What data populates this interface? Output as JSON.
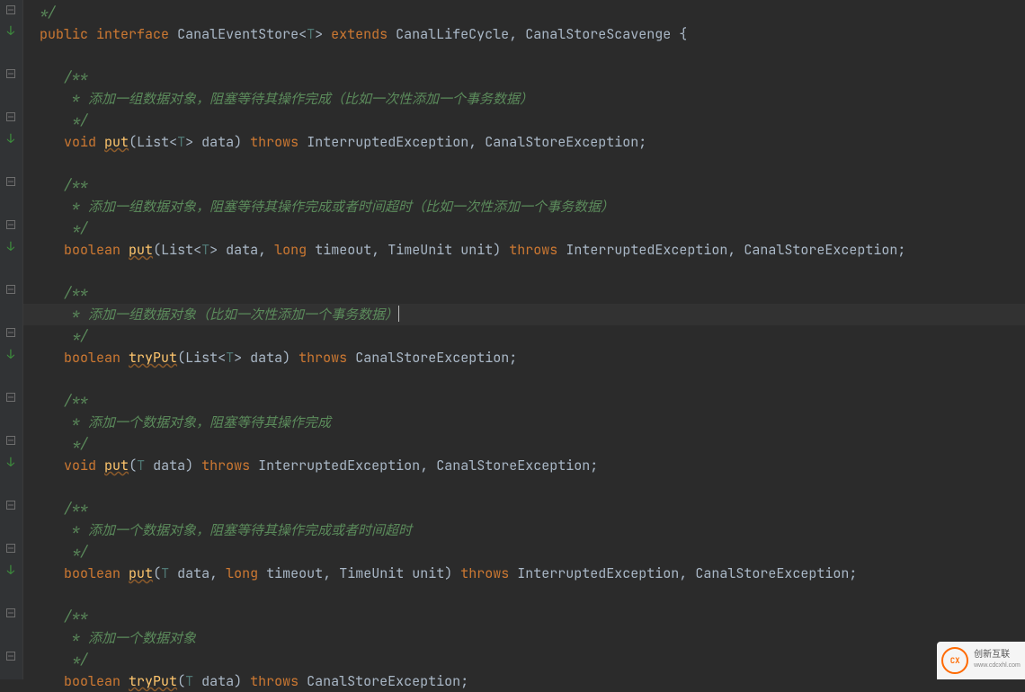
{
  "code": {
    "l1": "  */",
    "l2a": "  ",
    "l2_kw1": "public",
    "l2_s1": " ",
    "l2_kw2": "interface",
    "l2_s2": " ",
    "l2_id1": "CanalEventStore",
    "l2_p1": "<",
    "l2_tp": "T",
    "l2_p2": "> ",
    "l2_kw3": "extends",
    "l2_s3": " ",
    "l2_id2": "CanalLifeCycle",
    "l2_p3": ", ",
    "l2_id3": "CanalStoreScavenge",
    "l2_s4": " ",
    "l2_br": "{",
    "l4": "     /**",
    "l5": "      * 添加一组数据对象，阻塞等待其操作完成（比如一次性添加一个事务数据）",
    "l6": "      */",
    "l7a": "     ",
    "l7_kw": "void",
    "l7_s": " ",
    "l7_m": "put",
    "l7_p1": "(",
    "l7_id1": "List",
    "l7_p2": "<",
    "l7_tp": "T",
    "l7_p3": "> ",
    "l7_id2": "data",
    "l7_p4": ") ",
    "l7_kw2": "throws",
    "l7_s2": " ",
    "l7_id3": "InterruptedException",
    "l7_p5": ", ",
    "l7_id4": "CanalStoreException",
    "l7_p6": ";",
    "l9": "     /**",
    "l10": "      * 添加一组数据对象，阻塞等待其操作完成或者时间超时（比如一次性添加一个事务数据）",
    "l11": "      */",
    "l12a": "     ",
    "l12_kw": "boolean",
    "l12_s": " ",
    "l12_m": "put",
    "l12_p1": "(",
    "l12_id1": "List",
    "l12_p2": "<",
    "l12_tp": "T",
    "l12_p3": "> ",
    "l12_id2": "data",
    "l12_p4": ", ",
    "l12_kw2": "long",
    "l12_s2": " ",
    "l12_id3": "timeout",
    "l12_p5": ", ",
    "l12_id4": "TimeUnit",
    "l12_s3": " ",
    "l12_id5": "unit",
    "l12_p6": ") ",
    "l12_kw3": "throws",
    "l12_s4": " ",
    "l12_id6": "InterruptedException",
    "l12_p7": ", ",
    "l12_id7": "CanalStoreException",
    "l12_p8": ";",
    "l14": "     /**",
    "l15": "      * 添加一组数据对象（比如一次性添加一个事务数据）",
    "l16": "      */",
    "l17a": "     ",
    "l17_kw": "boolean",
    "l17_s": " ",
    "l17_m": "tryPut",
    "l17_p1": "(",
    "l17_id1": "List",
    "l17_p2": "<",
    "l17_tp": "T",
    "l17_p3": "> ",
    "l17_id2": "data",
    "l17_p4": ") ",
    "l17_kw2": "throws",
    "l17_s2": " ",
    "l17_id3": "CanalStoreException",
    "l17_p5": ";",
    "l19": "     /**",
    "l20": "      * 添加一个数据对象，阻塞等待其操作完成",
    "l21": "      */",
    "l22a": "     ",
    "l22_kw": "void",
    "l22_s": " ",
    "l22_m": "put",
    "l22_p1": "(",
    "l22_tp": "T",
    "l22_s2": " ",
    "l22_id2": "data",
    "l22_p2": ") ",
    "l22_kw2": "throws",
    "l22_s3": " ",
    "l22_id3": "InterruptedException",
    "l22_p3": ", ",
    "l22_id4": "CanalStoreException",
    "l22_p4": ";",
    "l24": "     /**",
    "l25": "      * 添加一个数据对象，阻塞等待其操作完成或者时间超时",
    "l26": "      */",
    "l27a": "     ",
    "l27_kw": "boolean",
    "l27_s": " ",
    "l27_m": "put",
    "l27_p1": "(",
    "l27_tp": "T",
    "l27_s2": " ",
    "l27_id2": "data",
    "l27_p2": ", ",
    "l27_kw2": "long",
    "l27_s3": " ",
    "l27_id3": "timeout",
    "l27_p3": ", ",
    "l27_id4": "TimeUnit",
    "l27_s4": " ",
    "l27_id5": "unit",
    "l27_p4": ") ",
    "l27_kw3": "throws",
    "l27_s5": " ",
    "l27_id6": "InterruptedException",
    "l27_p5": ", ",
    "l27_id7": "CanalStoreException",
    "l27_p6": ";",
    "l29": "     /**",
    "l30": "      * 添加一个数据对象",
    "l31": "      */",
    "l32a": "     ",
    "l32_kw": "boolean",
    "l32_s": " ",
    "l32_m": "tryPut",
    "l32_p1": "(",
    "l32_tp": "T",
    "l32_s2": " ",
    "l32_id2": "data",
    "l32_p2": ") ",
    "l32_kw2": "throws",
    "l32_s3": " ",
    "l32_id3": "CanalStoreException",
    "l32_p3": ";"
  },
  "logo": {
    "top": "CX",
    "name": "创新互联",
    "url": "www.cdcxhl.com"
  }
}
